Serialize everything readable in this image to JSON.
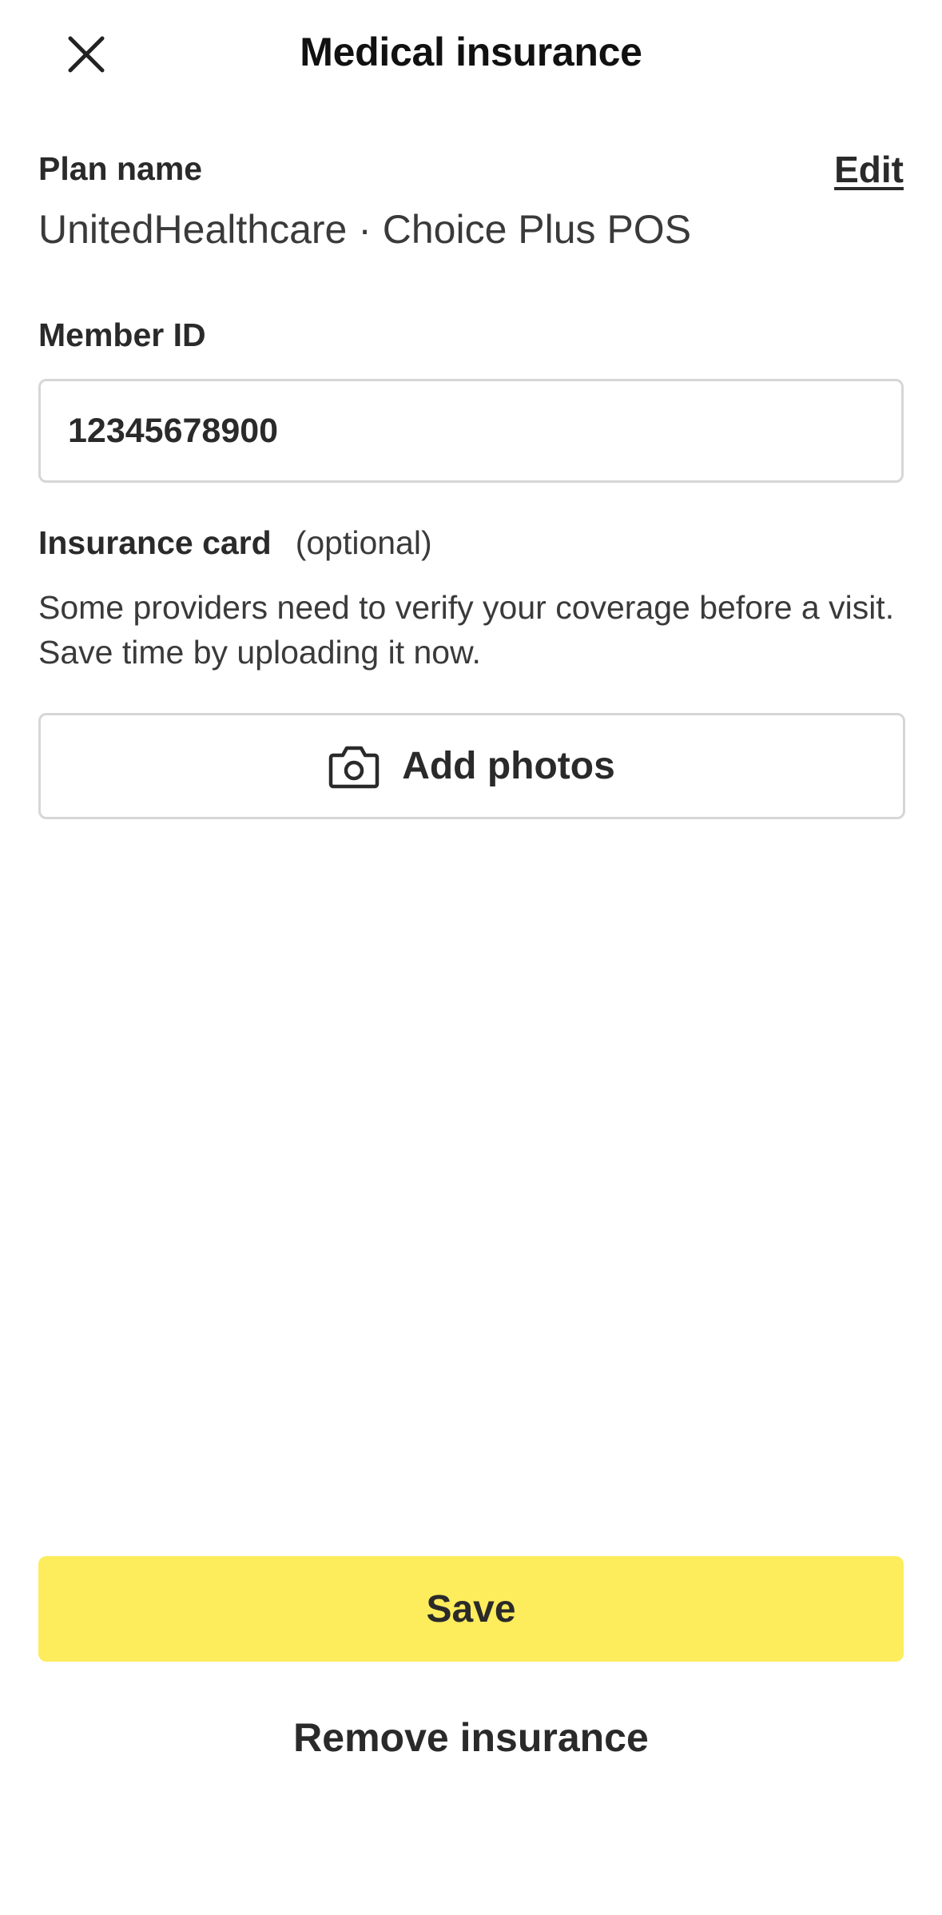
{
  "header": {
    "title": "Medical insurance",
    "close_icon": "close-icon"
  },
  "plan": {
    "label": "Plan name",
    "edit_label": "Edit",
    "value": "UnitedHealthcare · Choice Plus POS"
  },
  "member": {
    "label": "Member ID",
    "value": "12345678900"
  },
  "insurance_card": {
    "label": "Insurance card",
    "optional_label": "(optional)",
    "description": "Some providers need to verify your coverage before a visit. Save time by uploading it now.",
    "add_photos_label": "Add photos",
    "add_photos_icon": "camera-icon"
  },
  "actions": {
    "save_label": "Save",
    "remove_label": "Remove insurance"
  },
  "colors": {
    "accent": "#fdec5c",
    "border": "#d6d6d6",
    "text": "#2a2a2a"
  }
}
